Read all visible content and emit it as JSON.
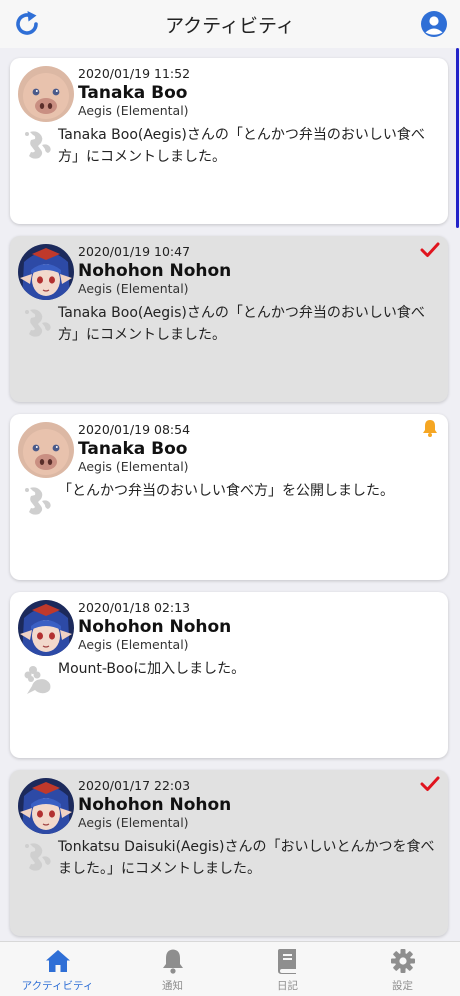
{
  "header": {
    "title": "アクティビティ"
  },
  "cards": [
    {
      "time": "2020/01/19 11:52",
      "name": "Tanaka Boo",
      "world": "Aegis (Elemental)",
      "message": "Tanaka Boo(Aegis)さんの「とんかつ弁当のおいしい食べ方」にコメントしました。",
      "avatar": "pig-avatar",
      "icon": "comment-icon",
      "badge": "",
      "read": false
    },
    {
      "time": "2020/01/19 10:47",
      "name": "Nohohon Nohon",
      "world": "Aegis (Elemental)",
      "message": "Tanaka Boo(Aegis)さんの「とんかつ弁当のおいしい食べ方」にコメントしました。",
      "avatar": "character-avatar",
      "icon": "comment-icon",
      "badge": "checkmark-icon",
      "read": true
    },
    {
      "time": "2020/01/19 08:54",
      "name": "Tanaka Boo",
      "world": "Aegis (Elemental)",
      "message": "「とんかつ弁当のおいしい食べ方」を公開しました。",
      "avatar": "pig-avatar",
      "icon": "comment-icon",
      "badge": "bell-icon",
      "read": false
    },
    {
      "time": "2020/01/18 02:13",
      "name": "Nohohon Nohon",
      "world": "Aegis (Elemental)",
      "message": "Mount-Booに加入しました。",
      "avatar": "character-avatar",
      "icon": "turnip-icon",
      "badge": "",
      "read": false
    },
    {
      "time": "2020/01/17 22:03",
      "name": "Nohohon Nohon",
      "world": "Aegis (Elemental)",
      "message": "Tonkatsu Daisuki(Aegis)さんの「おいしいとんかつを食べました。」にコメントしました。",
      "avatar": "character-avatar",
      "icon": "comment-icon",
      "badge": "checkmark-icon",
      "read": true
    }
  ],
  "tabbar": {
    "tabs": [
      {
        "label": "アクティビティ",
        "icon": "home-icon",
        "active": true
      },
      {
        "label": "通知",
        "icon": "bell-icon",
        "active": false
      },
      {
        "label": "日記",
        "icon": "book-icon",
        "active": false
      },
      {
        "label": "設定",
        "icon": "gear-icon",
        "active": false
      }
    ]
  },
  "colors": {
    "accent": "#2f6fd6",
    "read_card": "#e1e1e1",
    "check": "#e0141e",
    "bell": "#f5a623",
    "scroll": "#2323c8"
  }
}
